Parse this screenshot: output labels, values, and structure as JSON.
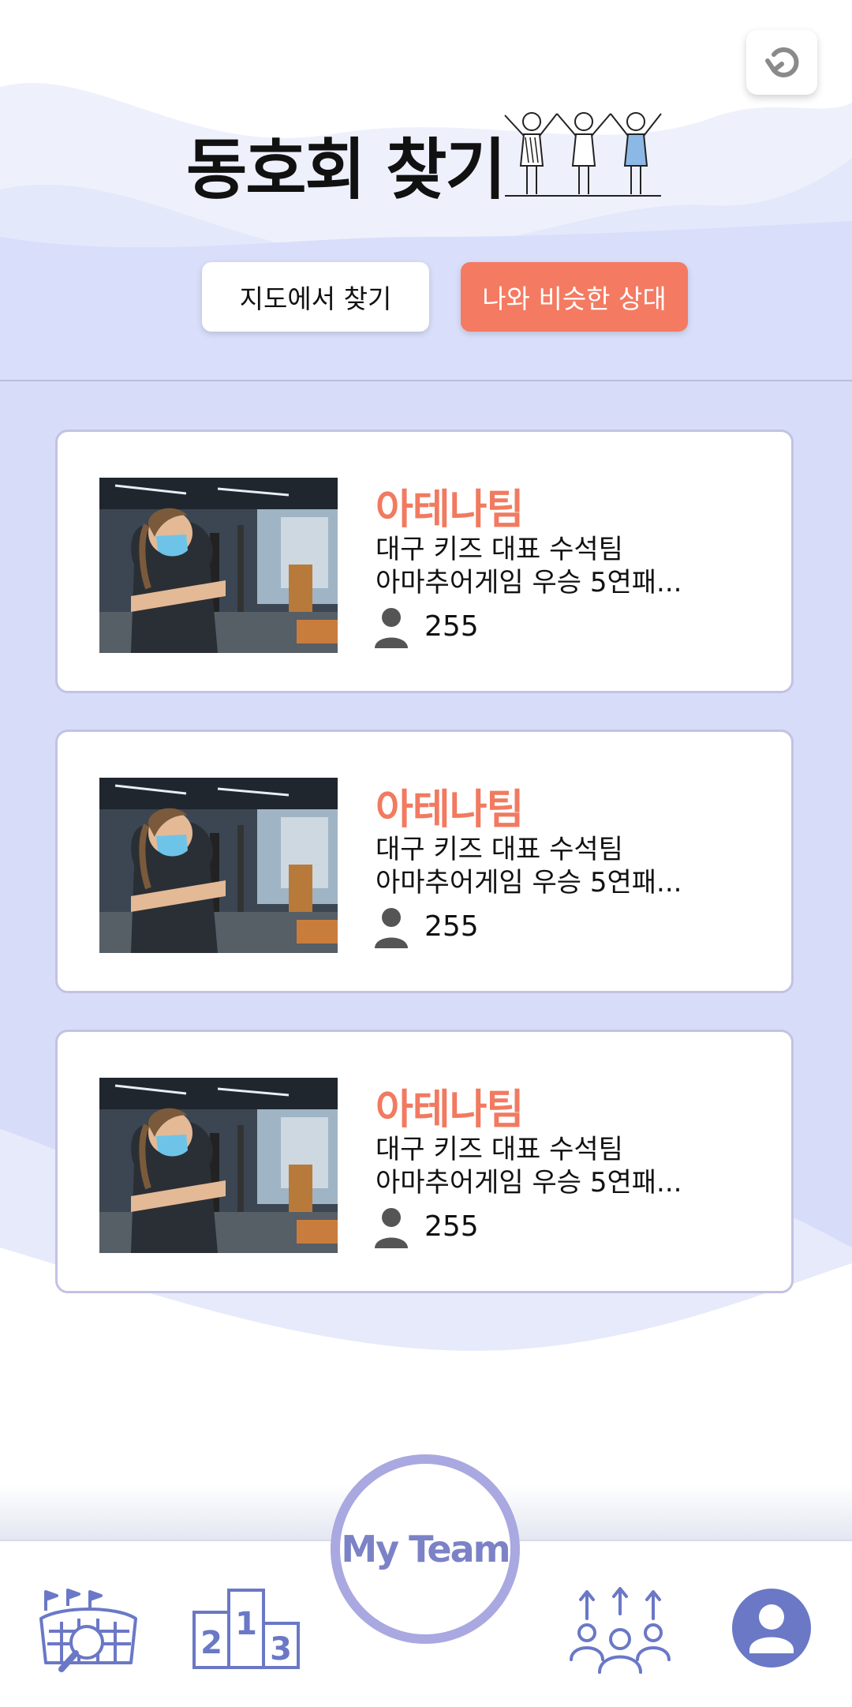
{
  "header": {
    "title": "동호회 찾기"
  },
  "tabs": [
    {
      "label": "지도에서 찾기",
      "active": false
    },
    {
      "label": "나와 비슷한 상대",
      "active": true
    }
  ],
  "teams": [
    {
      "name": "아테나팀",
      "desc_line1": "대구 키즈 대표 수석팀",
      "desc_line2": "아마추어게임 우승 5연패...",
      "members": "255"
    },
    {
      "name": "아테나팀",
      "desc_line1": "대구 키즈 대표 수석팀",
      "desc_line2": "아마추어게임 우승 5연패...",
      "members": "255"
    },
    {
      "name": "아테나팀",
      "desc_line1": "대구 키즈 대표 수석팀",
      "desc_line2": "아마추어게임 우승 5연패...",
      "members": "255"
    }
  ],
  "nav": {
    "my_team_label": "My Team",
    "icons": [
      "stadium-search-icon",
      "podium-ranking-icon",
      "my-team-button",
      "team-members-icon",
      "profile-icon"
    ]
  },
  "colors": {
    "accent": "#f47a62",
    "nav_primary": "#6a78c6",
    "card_border": "#c3c2e4",
    "background": "#dde3fa"
  }
}
